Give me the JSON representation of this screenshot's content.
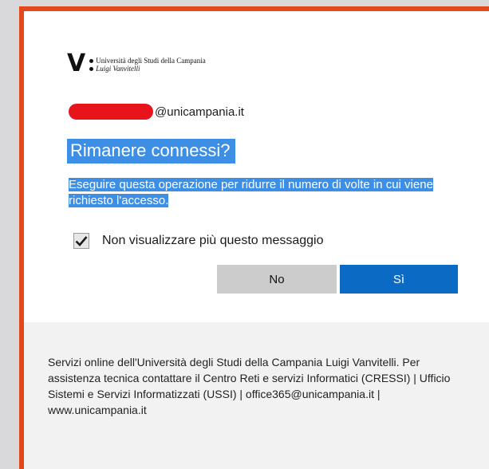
{
  "university": {
    "logo_mark": "V",
    "name_line1": "Università degli Studi della Campania",
    "name_line2": "Luigi Vanvitelli"
  },
  "account": {
    "domain": "@unicampania.it"
  },
  "dialog": {
    "title": "Rimanere connessi?",
    "description": "Eseguire questa operazione per ridurre il numero di volte in cui viene richiesto l'accesso.",
    "checkbox_label": "Non visualizzare più questo messaggio",
    "checkbox_checked": true,
    "no_label": "No",
    "yes_label": "Sì"
  },
  "footer": {
    "text": "Servizi online dell'Università degli Studi della Campania Luigi Vanvitelli. Per assistenza tecnica contattare il Centro Reti e servizi Informatici (CRESSI) | Ufficio Sistemi e Servizi Informatizzati (USSI) | office365@unicampania.it | www.unicampania.it"
  },
  "colors": {
    "frame_border": "#e2481b",
    "highlight": "#3d8ee5",
    "primary_button": "#0b6bc4",
    "secondary_button": "#cccccc",
    "redaction": "#e8141c"
  },
  "icons": {
    "checkbox": "checkmark-icon"
  }
}
